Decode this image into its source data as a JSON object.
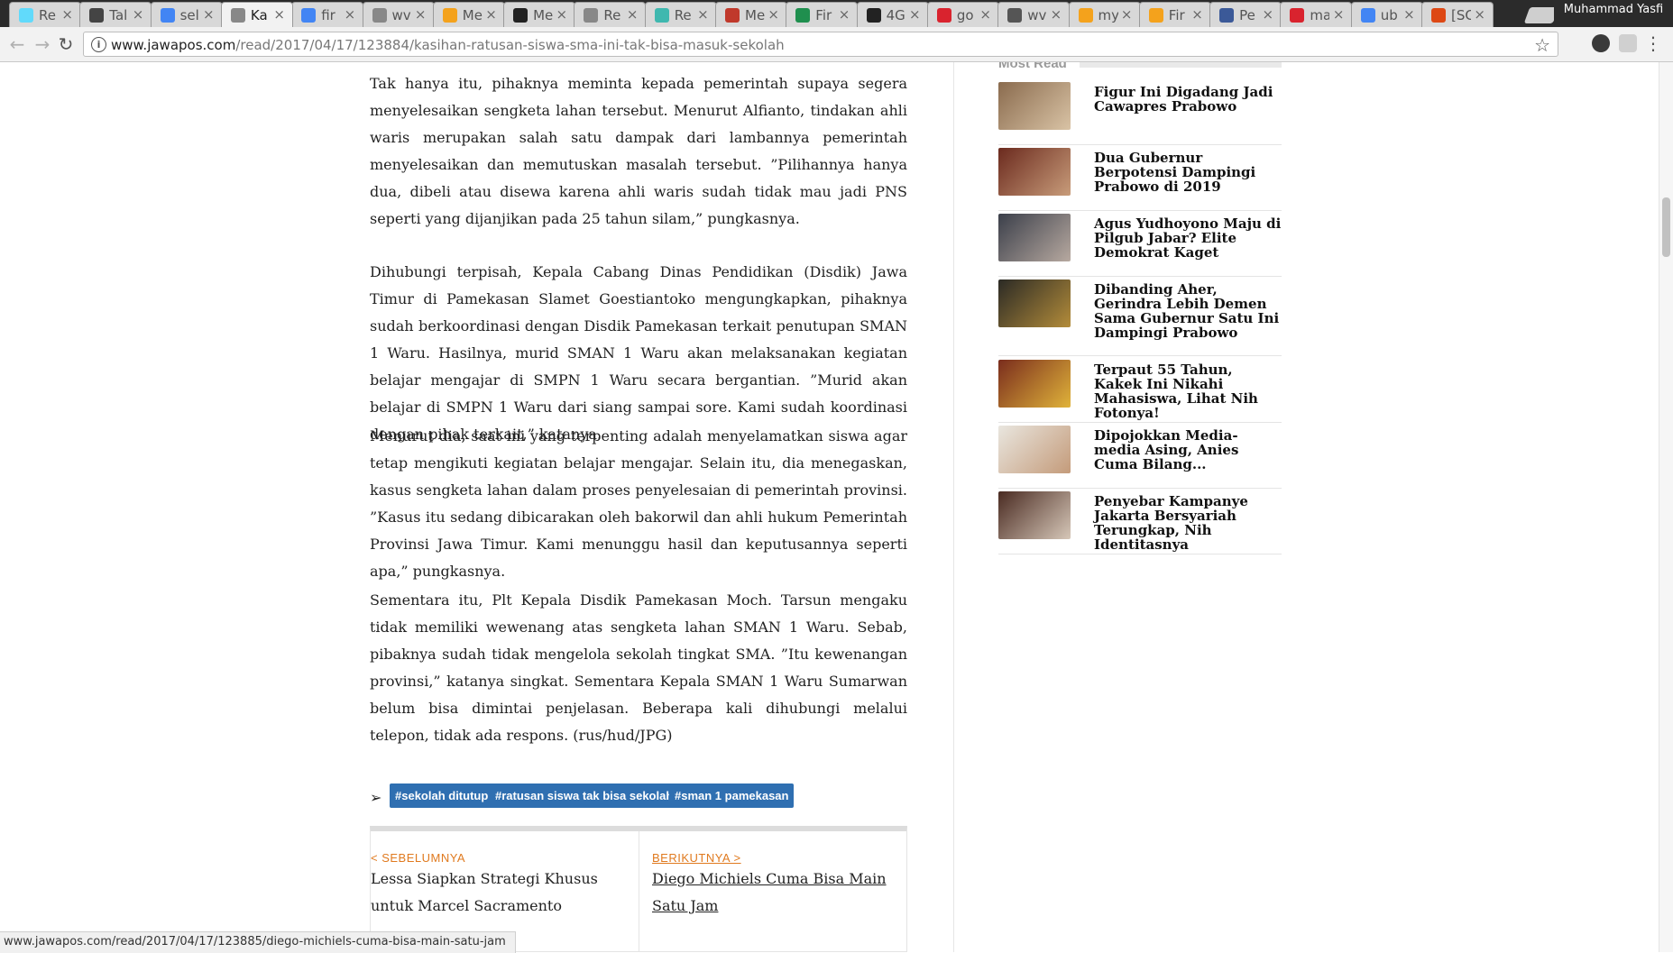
{
  "browser": {
    "user_name": "Muhammad Yasfi",
    "tabs": [
      {
        "label": "Re",
        "icon": "react-icon",
        "color": "#61dafb"
      },
      {
        "label": "Tal",
        "icon": "app-icon",
        "color": "#444444"
      },
      {
        "label": "sel",
        "icon": "google-icon",
        "color": "#4285f4"
      },
      {
        "label": "Ka",
        "icon": "page-icon",
        "color": "#888888",
        "active": true
      },
      {
        "label": "fir",
        "icon": "google-icon",
        "color": "#4285f4"
      },
      {
        "label": "wv",
        "icon": "page-icon",
        "color": "#888888"
      },
      {
        "label": "Me",
        "icon": "flame-icon",
        "color": "#f4a21c"
      },
      {
        "label": "Me",
        "icon": "github-icon",
        "color": "#222222"
      },
      {
        "label": "Re",
        "icon": "page-icon",
        "color": "#888888"
      },
      {
        "label": "Re",
        "icon": "refresh-icon",
        "color": "#3fb8af"
      },
      {
        "label": "Me",
        "icon": "circle-icon",
        "color": "#c0392b"
      },
      {
        "label": "Fir",
        "icon": "m-icon",
        "color": "#1f8f4e"
      },
      {
        "label": "4G",
        "icon": "github-icon",
        "color": "#222222"
      },
      {
        "label": "go",
        "icon": "n-icon",
        "color": "#d9232e"
      },
      {
        "label": "wv",
        "icon": "up-icon",
        "color": "#555555"
      },
      {
        "label": "my",
        "icon": "flame-icon",
        "color": "#f4a21c"
      },
      {
        "label": "Fir",
        "icon": "flame-icon",
        "color": "#f4a21c"
      },
      {
        "label": "Pe",
        "icon": "facebook-icon",
        "color": "#3b5998"
      },
      {
        "label": "ma",
        "icon": "n-icon",
        "color": "#d9232e"
      },
      {
        "label": "ub",
        "icon": "google-icon",
        "color": "#4285f4"
      },
      {
        "label": "[SC",
        "icon": "ubuntu-icon",
        "color": "#dd4814"
      }
    ],
    "url_host": "www.jawapos.com",
    "url_path": "/read/2017/04/17/123884/kasihan-ratusan-siswa-sma-ini-tak-bisa-masuk-sekolah",
    "status_url": "www.jawapos.com/read/2017/04/17/123885/diego-michiels-cuma-bisa-main-satu-jam"
  },
  "article": {
    "paragraphs": [
      "Tak hanya itu, pihaknya meminta kepada pemerintah supaya segera menyelesaikan sengketa lahan tersebut. Menurut Alfianto, tindakan ahli waris merupakan salah satu dampak dari lambannya pemerintah menyelesaikan dan memutuskan masalah tersebut. ”Pilihannya hanya dua, dibeli atau disewa karena ahli waris sudah tidak mau jadi PNS seperti yang dijanjikan pada 25 tahun silam,” pungkasnya.",
      "Dihubungi terpisah, Kepala Cabang Dinas Pendidikan (Disdik) Jawa Timur di Pamekasan Slamet Goestiantoko mengungkapkan, pihaknya sudah berkoordinasi dengan Disdik Pamekasan terkait penutupan SMAN 1 Waru. Hasilnya, murid SMAN 1 Waru akan melaksanakan kegiatan belajar mengajar di SMPN 1 Waru secara bergantian. ”Murid akan belajar di SMPN 1 Waru dari siang sampai sore. Kami sudah koordinasi dengan pihak terkait,” katanya.",
      "Menurut dia, saat ini yang terpenting adalah menyelamatkan siswa agar tetap mengikuti kegiatan belajar mengajar. Selain itu, dia menegaskan, kasus sengketa lahan dalam proses penyelesaian di pemerintah provinsi. ”Kasus itu sedang dibicarakan oleh bakorwil dan ahli hukum Pemerintah Provinsi Jawa Timur. Kami menunggu hasil dan keputusannya seperti apa,” pungkasnya.",
      "Sementara itu, Plt Kepala Disdik Pamekasan Moch. Tarsun mengaku tidak memiliki wewenang atas sengketa lahan SMAN 1 Waru. Sebab, pibaknya sudah tidak mengelola sekolah tingkat SMA. ”Itu kewenangan provinsi,” katanya singkat. Sementara Kepala SMAN 1 Waru Sumarwan belum bisa dimintai penjelasan. Beberapa kali dihubungi melalui telepon, tidak ada respons. (rus/hud/JPG)"
    ],
    "tags": [
      "#sekolah ditutup",
      "#ratusan siswa tak bisa sekolah",
      "#sman 1 pamekasan"
    ],
    "prev": {
      "label": "< SEBELUMNYA",
      "title": "Lessa Siapkan Strategi Khusus untuk Marcel Sacramento"
    },
    "next": {
      "label": "BERIKUTNYA >",
      "title": "Diego Michiels Cuma Bisa Main Satu Jam"
    }
  },
  "sidebar": {
    "title": "Most Read",
    "items": [
      "Figur Ini Digadang Jadi Cawapres Prabowo",
      "Dua Gubernur Berpotensi Dampingi Prabowo di 2019",
      "Agus Yudhoyono Maju di Pilgub Jabar? Elite Demokrat Kaget",
      "Dibanding Aher, Gerindra Lebih Demen Sama Gubernur Satu Ini Dampingi Prabowo",
      "Terpaut 55 Tahun, Kakek Ini Nikahi Mahasiswa, Lihat Nih Fotonya!",
      "Dipojokkan Media-media Asing, Anies Cuma Bilang...",
      "Penyebar Kampanye Jakarta Bersyariah Terungkap, Nih Identitasnya"
    ]
  },
  "colors": {
    "tag_bg": "#2f6fb1",
    "nav_label": "#e07a1f"
  }
}
